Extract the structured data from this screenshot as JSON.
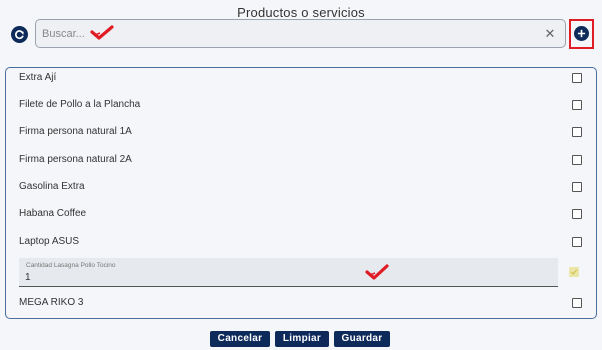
{
  "dialog": {
    "title": "Productos o servicios"
  },
  "search": {
    "placeholder": "Buscar...",
    "value": ""
  },
  "icons": {
    "refresh": "refresh-icon",
    "clear": "close-icon",
    "add": "plus-icon",
    "annotation": "red-check-annotation",
    "checkbox_checked": "check-icon"
  },
  "items": [
    {
      "label": "Extra Ají",
      "checked": false
    },
    {
      "label": "Filete de Pollo a la Plancha",
      "checked": false
    },
    {
      "label": "Firma persona natural 1A",
      "checked": false
    },
    {
      "label": "Firma persona natural 2A",
      "checked": false
    },
    {
      "label": "Gasolina Extra",
      "checked": false
    },
    {
      "label": "Habana Coffee",
      "checked": false
    },
    {
      "label": "Laptop ASUS",
      "checked": false
    }
  ],
  "quantity_field": {
    "label": "Cantidad Lasagna Pollo Tocino",
    "value": "1",
    "checked": true
  },
  "items_after": [
    {
      "label": "MEGA RIKO 3",
      "checked": false
    }
  ],
  "buttons": {
    "cancel": "Cancelar",
    "clear": "Limpiar",
    "save": "Guardar"
  },
  "colors": {
    "primary": "#0d2a5a",
    "highlight_border": "#e01d24",
    "annotation": "#e01d24",
    "panel_border": "#4a6ea0",
    "checked_bg": "#ece5a8"
  }
}
